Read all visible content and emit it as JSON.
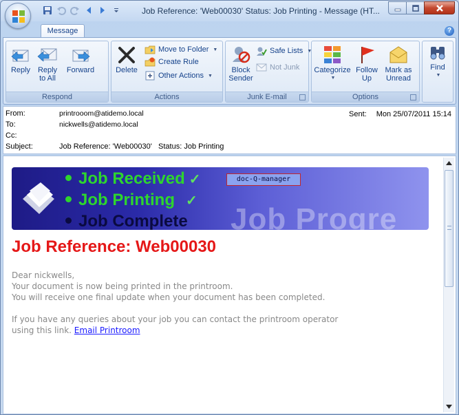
{
  "window": {
    "title": "Job Reference: 'Web00030'   Status: Job Printing - Message (HT...",
    "accent": "#15428b"
  },
  "tabs": [
    {
      "label": "Message"
    }
  ],
  "ribbon": {
    "respond": {
      "label": "Respond",
      "reply": "Reply",
      "reply_all_1": "Reply",
      "reply_all_2": "to All",
      "forward": "Forward"
    },
    "actions": {
      "label": "Actions",
      "delete": "Delete",
      "move_to_folder": "Move to Folder",
      "create_rule": "Create Rule",
      "other_actions": "Other Actions"
    },
    "junk": {
      "label": "Junk E-mail",
      "block_1": "Block",
      "block_2": "Sender",
      "safe_lists": "Safe Lists",
      "not_junk": "Not Junk"
    },
    "options": {
      "label": "Options",
      "categorize": "Categorize",
      "follow_1": "Follow",
      "follow_2": "Up",
      "mark_1": "Mark as",
      "mark_2": "Unread"
    },
    "find": {
      "label": "Find"
    }
  },
  "header": {
    "from_label": "From:",
    "from": "printrooom@atidemo.local",
    "to_label": "To:",
    "to": "nickwells@atidemo.local",
    "cc_label": "Cc:",
    "cc": "",
    "subject_label": "Subject:",
    "subject": "Job Reference: 'Web00030'   Status: Job Printing",
    "sent_label": "Sent:",
    "sent": "Mon 25/07/2011 15:14"
  },
  "body": {
    "banner": {
      "step1": "Job Received",
      "step2": "Job Printing",
      "step3": "Job Complete",
      "tick": "✓",
      "brand": "doc-Q-manager",
      "watermark": "Job Progre"
    },
    "job_reference": "Job Reference: Web00030",
    "greeting": "Dear nickwells,",
    "line1": "Your document is now being printed in the printroom.",
    "line2": "You will receive one final update when your document has been completed.",
    "query1": "If you have any queries about your job you can contact the printroom operator",
    "query2": "using this link. ",
    "link": "Email Printroom"
  }
}
